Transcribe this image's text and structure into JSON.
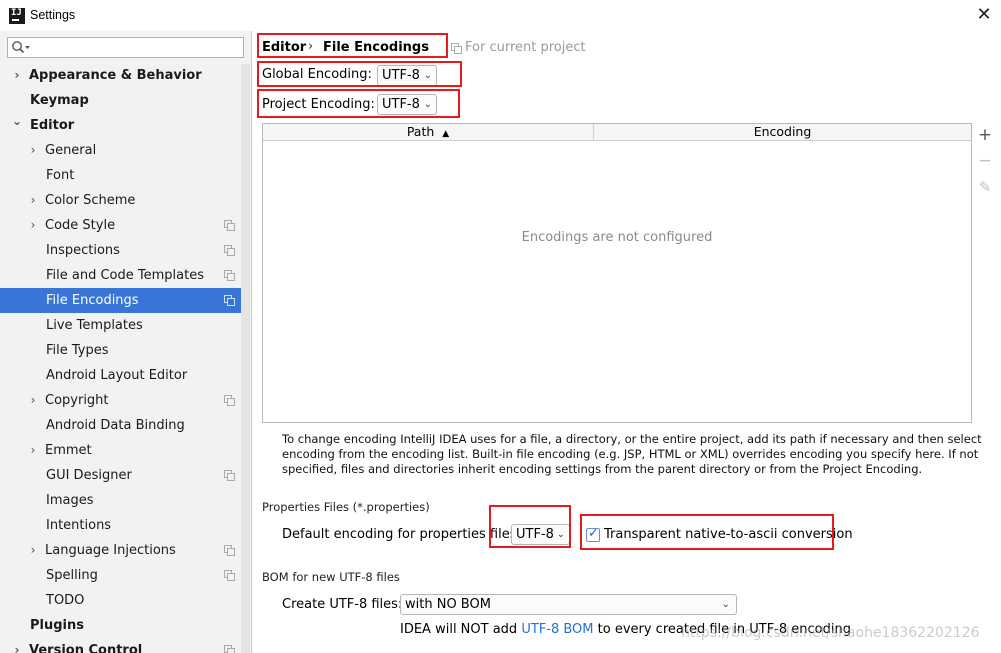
{
  "window": {
    "title": "Settings",
    "close_glyph": "✕",
    "app_icon": "intellij-icon"
  },
  "search": {
    "placeholder": "",
    "value": ""
  },
  "sidebar": {
    "items": [
      {
        "label": "Appearance & Behavior",
        "arrow": "›"
      },
      {
        "label": "Keymap"
      },
      {
        "label": "Editor",
        "arrow": "⌄"
      },
      {
        "label": "General",
        "arrow": "›"
      },
      {
        "label": "Font"
      },
      {
        "label": "Color Scheme",
        "arrow": "›"
      },
      {
        "label": "Code Style",
        "arrow": "›"
      },
      {
        "label": "Inspections"
      },
      {
        "label": "File and Code Templates"
      },
      {
        "label": "File Encodings",
        "selected": true
      },
      {
        "label": "Live Templates"
      },
      {
        "label": "File Types"
      },
      {
        "label": "Android Layout Editor"
      },
      {
        "label": "Copyright",
        "arrow": "›"
      },
      {
        "label": "Android Data Binding"
      },
      {
        "label": "Emmet",
        "arrow": "›"
      },
      {
        "label": "GUI Designer"
      },
      {
        "label": "Images"
      },
      {
        "label": "Intentions"
      },
      {
        "label": "Language Injections",
        "arrow": "›"
      },
      {
        "label": "Spelling"
      },
      {
        "label": "TODO"
      },
      {
        "label": "Plugins"
      },
      {
        "label": "Version Control",
        "arrow": "›"
      }
    ]
  },
  "breadcrumb": {
    "parent": "Editor",
    "separator": "›",
    "current": "File Encodings",
    "scope_hint": "For current project"
  },
  "global_encoding": {
    "label": "Global Encoding:",
    "value": "UTF-8"
  },
  "project_encoding": {
    "label": "Project Encoding:",
    "value": "UTF-8"
  },
  "table": {
    "columns": [
      "Path",
      "Encoding"
    ],
    "sort_indicator": "▲",
    "empty_message": "Encodings are not configured",
    "tools": {
      "add": "+",
      "remove": "−",
      "edit": "✎"
    }
  },
  "help_text": "To change encoding IntelliJ IDEA uses for a file, a directory, or the entire project, add its path if necessary and then select encoding from the encoding list. Built-in file encoding (e.g. JSP, HTML or XML) overrides encoding you specify here. If not specified, files and directories inherit encoding settings from the parent directory or from the Project Encoding.",
  "properties": {
    "section_title": "Properties Files (*.properties)",
    "default_label": "Default encoding for properties files:",
    "default_value": "UTF-8",
    "native_to_ascii_label": "Transparent native-to-ascii conversion",
    "native_to_ascii_checked": true
  },
  "bom": {
    "section_title": "BOM for new UTF-8 files",
    "create_label": "Create UTF-8 files:",
    "create_value": "with NO BOM",
    "note_before": "IDEA will NOT add ",
    "note_link": "UTF-8 BOM",
    "note_after": " to every created file in UTF-8 encoding"
  },
  "watermark": "https://blog.csdn.net/shaohe18362202126",
  "colors": {
    "selection": "#3875d7",
    "highlight": "#e8181b",
    "link": "#2470d8"
  }
}
